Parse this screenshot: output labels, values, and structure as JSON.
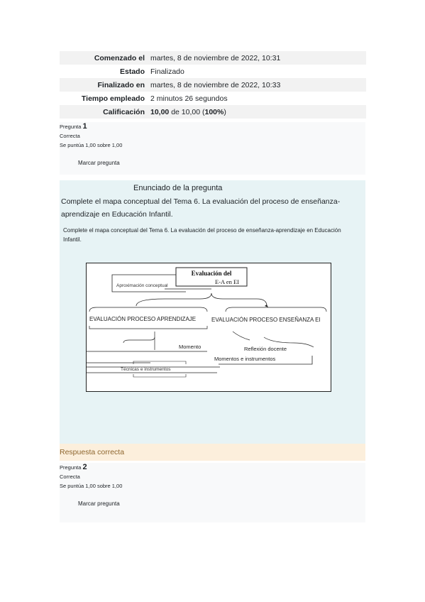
{
  "summary": {
    "rows": [
      {
        "label": "Comenzado el",
        "value": "martes, 8 de noviembre de 2022, 10:31"
      },
      {
        "label": "Estado",
        "value": "Finalizado"
      },
      {
        "label": "Finalizado en",
        "value": "martes, 8 de noviembre de 2022, 10:33"
      },
      {
        "label": "Tiempo empleado",
        "value": "2 minutos 26 segundos"
      },
      {
        "label": "Calificación",
        "value_bold": "10,00",
        "value_mid": " de 10,00 (",
        "value_pct": "100%",
        "value_end": ")"
      }
    ]
  },
  "questions": [
    {
      "prefix": "Pregunta ",
      "number": "1",
      "status": "Correcta",
      "score": "Se puntúa 1,00 sobre 1,00",
      "flag": "Marcar pregunta"
    },
    {
      "prefix": "Pregunta ",
      "number": "2",
      "status": "Correcta",
      "score": "Se puntúa 1,00 sobre 1,00",
      "flag": "Marcar pregunta"
    }
  ],
  "question_text": {
    "header": "Enunciado de la pregunta",
    "intro": "Complete el mapa conceptual del Tema 6. La evaluación del proceso de enseñanza-aprendizaje en Educación Infantil.",
    "inner": "Complete el mapa conceptual del Tema 6. La evaluación del proceso de enseñanza-aprendizaje en Educación Infantil."
  },
  "diagram": {
    "title_line1": "Evaluación del",
    "title_line2": "E-A en EI",
    "aproximacion": "Aproximación conceptual",
    "left_branch": "EVALUACIÓN PROCESO APRENDIZAJE",
    "right_branch": "EVALUACIÓN PROCESO ENSEÑANZA EI",
    "momento": "Momento",
    "reflexion": "Reflexión docente",
    "momentos_instr": "Momentos e instrumentos",
    "tecnicas": "Técnicas e instrumentos"
  },
  "feedback": "Respuesta correcta"
}
